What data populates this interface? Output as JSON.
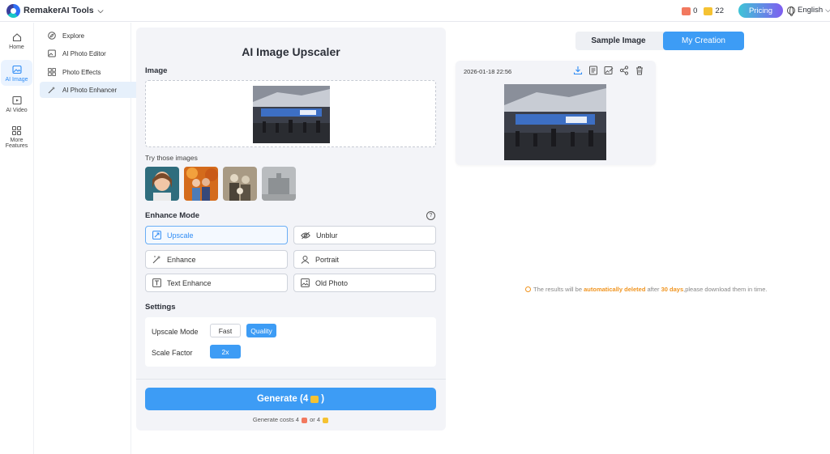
{
  "header": {
    "brand": "Remaker",
    "ai_tools": "AI Tools",
    "credit_red": "0",
    "credit_gold": "22",
    "pricing": "Pricing",
    "language": "English"
  },
  "rail": [
    {
      "label": "Home",
      "icon": "home-icon"
    },
    {
      "label": "AI Image",
      "icon": "image-icon",
      "active": true
    },
    {
      "label": "AI Video",
      "icon": "video-icon"
    },
    {
      "label_line1": "More",
      "label_line2": "Features",
      "icon": "grid-icon"
    }
  ],
  "menu": [
    {
      "label": "Explore",
      "icon": "compass-icon"
    },
    {
      "label": "AI Photo Editor",
      "icon": "photo-editor-icon"
    },
    {
      "label": "Photo Effects",
      "icon": "effects-grid-icon"
    },
    {
      "label": "AI Photo Enhancer",
      "icon": "magic-wand-icon",
      "active": true
    }
  ],
  "panel": {
    "title": "AI Image Upscaler",
    "image_label": "Image",
    "try_label": "Try those images",
    "enhance_mode_label": "Enhance Mode",
    "modes": [
      {
        "label": "Upscale",
        "icon": "upscale-icon",
        "active": true
      },
      {
        "label": "Unblur",
        "icon": "eye-icon"
      },
      {
        "label": "Enhance",
        "icon": "sparkle-wand-icon"
      },
      {
        "label": "Portrait",
        "icon": "portrait-icon"
      },
      {
        "label": "Text Enhance",
        "icon": "text-icon"
      },
      {
        "label": "Old Photo",
        "icon": "old-photo-icon"
      }
    ],
    "settings_label": "Settings",
    "upscale_mode_label": "Upscale Mode",
    "upscale_options": [
      "Fast",
      "Quality"
    ],
    "upscale_selected": "Quality",
    "scale_factor_label": "Scale Factor",
    "scale_factor_value": "2x",
    "generate_prefix": "Generate (4",
    "generate_suffix": ")",
    "cost_prefix": "Generate costs 4",
    "cost_middle": "or 4"
  },
  "result": {
    "tab_sample": "Sample Image",
    "tab_creation": "My Creation",
    "active_tab": "My Creation",
    "timestamp": "2026-01-18 22:56",
    "notice_prefix": "The results will be",
    "notice_highlight1": "automatically deleted",
    "notice_middle": "after",
    "notice_highlight2": "30 days",
    "notice_suffix": ",please download them in time."
  },
  "colors": {
    "accent": "#3d9cf5",
    "warning": "#f0941f",
    "panel_bg": "#f3f4f8"
  }
}
